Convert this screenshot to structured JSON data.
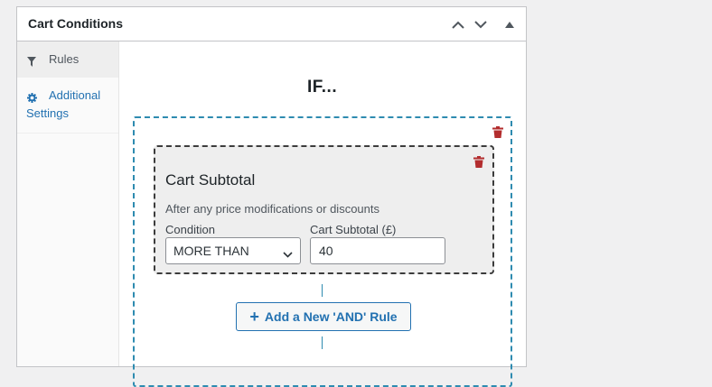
{
  "panel": {
    "title": "Cart Conditions"
  },
  "sidebar": {
    "items": [
      {
        "label": "Rules",
        "icon": "filter-icon",
        "active": true
      },
      {
        "label_line1": "Additional",
        "label_line2": "Settings",
        "icon": "gear-icon",
        "active": false
      }
    ]
  },
  "main": {
    "if_label": "IF...",
    "rule": {
      "title": "Cart Subtotal",
      "description": "After any price modifications or discounts",
      "condition_label": "Condition",
      "condition_value": "MORE THAN",
      "subtotal_label": "Cart Subtotal (£)",
      "subtotal_value": "40"
    },
    "add_and_rule_label": "Add a New 'AND' Rule"
  },
  "colors": {
    "accent": "#2271b1",
    "group_border": "#2e8bb0",
    "trash": "#b32d2e"
  }
}
